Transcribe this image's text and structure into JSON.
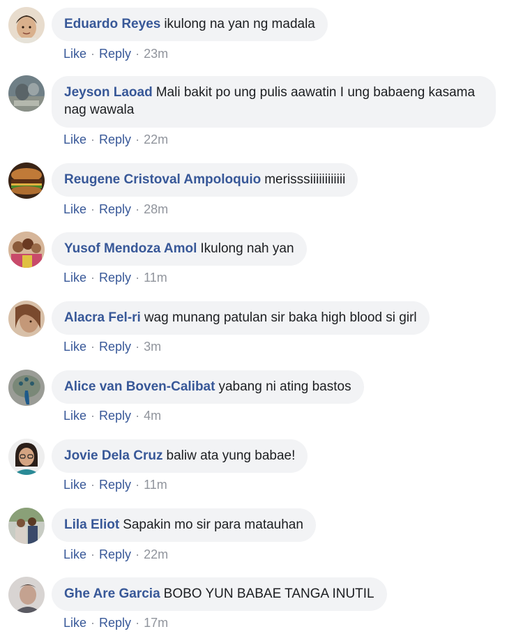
{
  "labels": {
    "like": "Like",
    "reply": "Reply"
  },
  "comments": [
    {
      "author": "Eduardo Reyes",
      "text": "ikulong na yan ng madala",
      "time": "23m",
      "avatar_icon": "boy-portrait-avatar",
      "avatar_color": "#d9c2a6"
    },
    {
      "author": "Jeyson Laoad",
      "text": "Mali bakit po ung pulis aawatin I ung babaeng kasama nag wawala",
      "time": "22m",
      "avatar_icon": "blurry-photo-avatar",
      "avatar_color": "#7b8a8e"
    },
    {
      "author": "Reugene Cristoval Ampoloquio",
      "text": "merisssiiiiiiiiiiii",
      "time": "28m",
      "avatar_icon": "burger-avatar",
      "avatar_color": "#6b3a1e"
    },
    {
      "author": "Yusof Mendoza Amol",
      "text": "Ikulong nah yan",
      "time": "11m",
      "avatar_icon": "group-photo-avatar",
      "avatar_color": "#c87a4a"
    },
    {
      "author": "Alacra Fel-ri",
      "text": "wag munang patulan sir baka high blood si girl",
      "time": "3m",
      "avatar_icon": "woman-portrait-avatar",
      "avatar_color": "#c9a38a"
    },
    {
      "author": "Alice van Boven-Calibat",
      "text": "yabang ni ating bastos",
      "time": "4m",
      "avatar_icon": "peacock-avatar",
      "avatar_color": "#8a8f88"
    },
    {
      "author": "Jovie Dela Cruz",
      "text": "baliw ata yung babae!",
      "time": "11m",
      "avatar_icon": "woman-glasses-avatar",
      "avatar_color": "#2f7f8a"
    },
    {
      "author": "Lila Eliot",
      "text": "Sapakin mo sir para matauhan",
      "time": "22m",
      "avatar_icon": "family-photo-avatar",
      "avatar_color": "#a0a8a0"
    },
    {
      "author": "Ghe Are Garcia",
      "text": "BOBO YUN BABAE TANGA INUTIL",
      "time": "17m",
      "avatar_icon": "man-portrait-avatar",
      "avatar_color": "#b8b0ac"
    }
  ]
}
